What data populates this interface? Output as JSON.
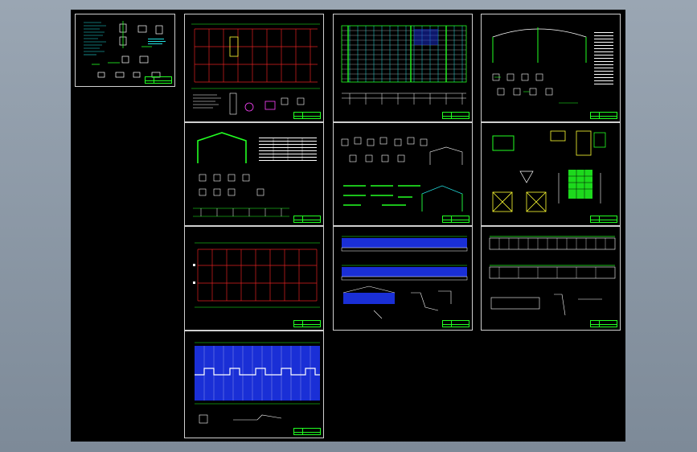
{
  "viewer": {
    "background_top": "#9aa6b3",
    "background_bottom": "#7d8a98",
    "canvas_color": "#000000"
  },
  "colors": {
    "frame": "#cfcfcf",
    "red_grid": "#e02020",
    "green": "#22ff22",
    "blue_fill": "#1a2fd6",
    "cyan": "#22e0e0",
    "white": "#ffffff",
    "yellow": "#ffff33"
  },
  "sheets": [
    {
      "id": "s1",
      "kind": "notes"
    },
    {
      "id": "s2",
      "kind": "plan-red"
    },
    {
      "id": "s3",
      "kind": "plan-dense"
    },
    {
      "id": "s4",
      "kind": "frame-elevation"
    },
    {
      "id": "s5",
      "kind": "frame-details"
    },
    {
      "id": "s6",
      "kind": "details"
    },
    {
      "id": "s7",
      "kind": "details-green"
    },
    {
      "id": "s8",
      "kind": "plan-red-2"
    },
    {
      "id": "s9",
      "kind": "elevation-blue"
    },
    {
      "id": "s10",
      "kind": "elevation-white"
    },
    {
      "id": "s11",
      "kind": "roof-blue"
    }
  ]
}
